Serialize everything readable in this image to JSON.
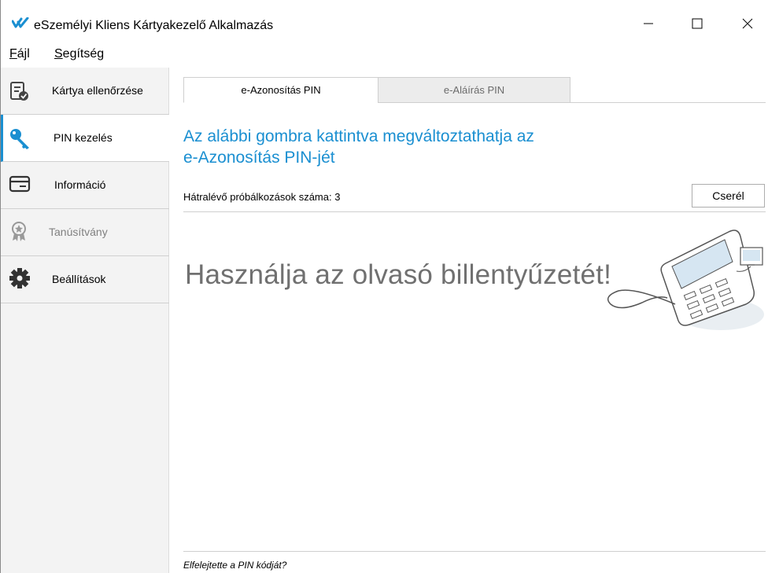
{
  "window": {
    "title": "eSzemélyi Kliens Kártyakezelő Alkalmazás",
    "controls": {
      "minimize_glyph": "—",
      "maximize_glyph": "☐",
      "close_glyph": "✕"
    }
  },
  "menu": {
    "file": {
      "accel": "F",
      "rest": "ájl"
    },
    "help": {
      "accel": "S",
      "rest": "egítség"
    }
  },
  "sidebar": {
    "items": [
      {
        "label": "Kártya ellenőrzése",
        "icon": "card-check-icon"
      },
      {
        "label": "PIN kezelés",
        "icon": "key-icon"
      },
      {
        "label": "Információ",
        "icon": "credit-card-icon"
      },
      {
        "label": "Tanúsítvány",
        "icon": "certificate-badge-icon"
      },
      {
        "label": "Beállítások",
        "icon": "gear-icon"
      }
    ]
  },
  "tabs": [
    {
      "label": "e-Azonosítás PIN"
    },
    {
      "label": "e-Aláírás PIN"
    }
  ],
  "main": {
    "heading_line1": "Az alábbi gombra kattintva megváltoztathatja az",
    "heading_line2": "e-Azonosítás PIN-jét",
    "attempts_label": "Hátralévő próbálkozások száma: 3",
    "change_button": "Cserél",
    "instruction": "Használja az olvasó billentyűzetét!",
    "forgot_link": "Elfelejtette a PIN kódját?"
  },
  "colors": {
    "accent": "#1a8fd1",
    "sidebar_bg": "#f3f3f3",
    "instruction_text": "#707070"
  }
}
